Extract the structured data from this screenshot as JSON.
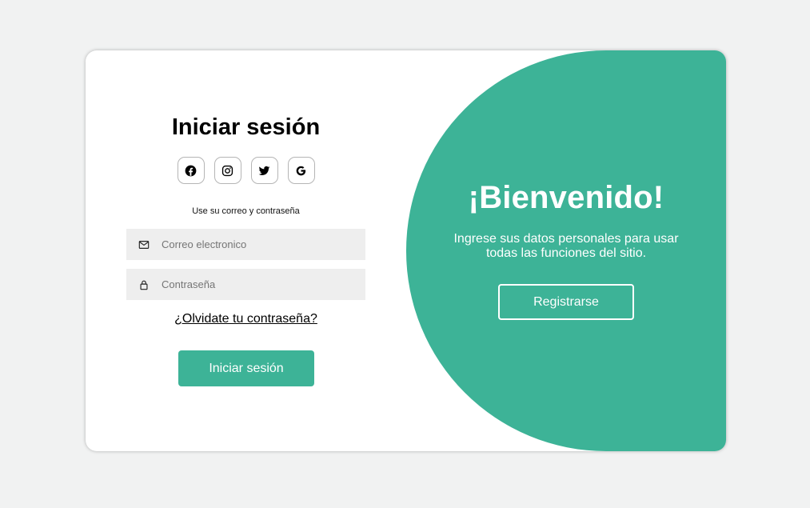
{
  "login": {
    "title": "Iniciar sesión",
    "social": [
      {
        "name": "facebook",
        "icon": "facebook-icon"
      },
      {
        "name": "instagram",
        "icon": "instagram-icon"
      },
      {
        "name": "twitter",
        "icon": "twitter-icon"
      },
      {
        "name": "google",
        "icon": "google-icon"
      }
    ],
    "hint": "Use su correo y contraseña",
    "email": {
      "placeholder": "Correo electronico",
      "value": "",
      "icon": "mail-icon"
    },
    "password": {
      "placeholder": "Contraseña",
      "value": "",
      "icon": "lock-icon"
    },
    "forgot_label": "¿Olvidate tu contraseña?",
    "submit_label": "Iniciar sesión"
  },
  "welcome": {
    "title": "¡Bienvenido!",
    "text": "Ingrese sus datos personales para usar todas las funciones del sitio.",
    "register_label": "Registrarse"
  },
  "colors": {
    "accent": "#3db397",
    "background": "#f1f2f2",
    "field_background": "#eeeeee"
  }
}
